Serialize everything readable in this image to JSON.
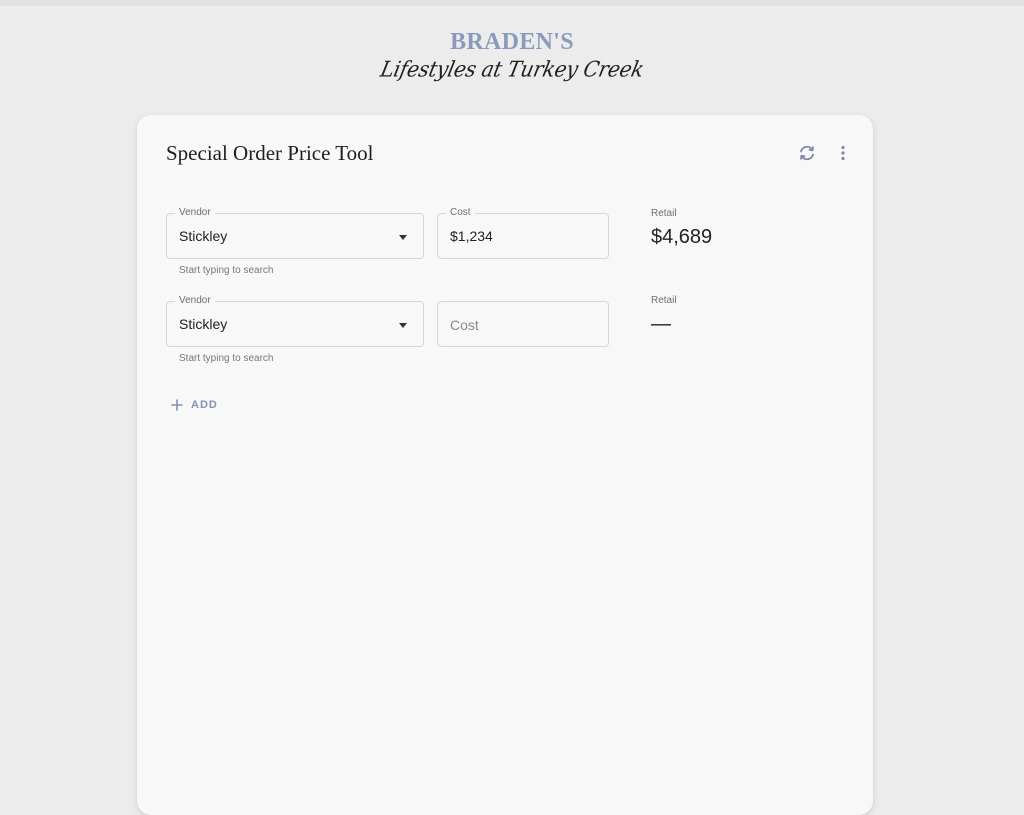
{
  "logo": {
    "brand": "BRADEN'S",
    "tagline": "Lifestyles at Turkey Creek"
  },
  "card": {
    "title": "Special Order Price Tool",
    "actions": [
      {
        "icon": "refresh-icon"
      },
      {
        "icon": "more-vert-icon"
      }
    ]
  },
  "rows": [
    {
      "vendor_label": "Vendor",
      "vendor_value": "Stickley",
      "vendor_helper": "Start typing to search",
      "cost_label": "Cost",
      "cost_value": "$1,234",
      "retail_label": "Retail",
      "retail_value": "$4,689"
    },
    {
      "vendor_label": "Vendor",
      "vendor_value": "Stickley",
      "vendor_helper": "Start typing to search",
      "cost_placeholder": "Cost",
      "retail_label": "Retail",
      "retail_value": "—"
    }
  ],
  "add_button": {
    "label": "ADD",
    "icon": "plus-icon"
  },
  "colors": {
    "brand": "#8b9abb",
    "accent": "#8492ad",
    "background": "#ececec",
    "card": "#f8f8f8"
  }
}
